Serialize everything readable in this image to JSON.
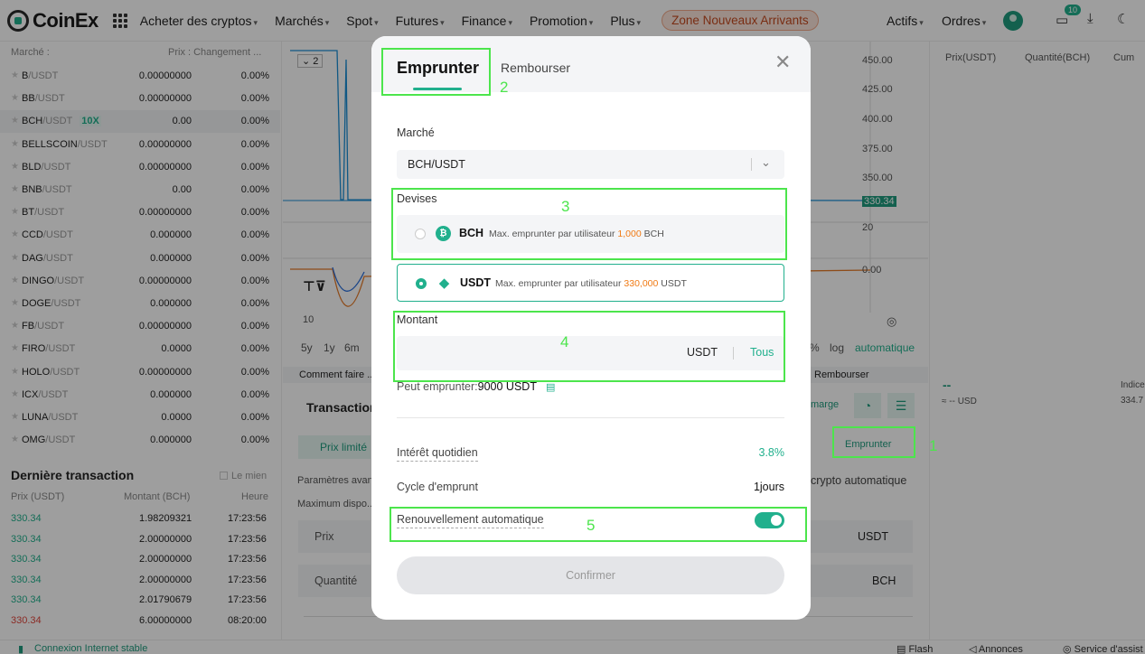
{
  "nav": {
    "brand": "CoinEx",
    "items": [
      "Acheter des cryptos",
      "Marchés",
      "Spot",
      "Futures",
      "Finance",
      "Promotion",
      "Plus"
    ],
    "zone": "Zone Nouveaux Arrivants",
    "right_items": [
      "Actifs",
      "Ordres"
    ],
    "notif_count": "10"
  },
  "market": {
    "header": "Marché :",
    "header2": "Prix : Changement ...",
    "rows": [
      {
        "base": "B",
        "quote": "/USDT",
        "price": "0.00000000",
        "chg": "0.00%"
      },
      {
        "base": "BB",
        "quote": "/USDT",
        "price": "0.00000000",
        "chg": "0.00%"
      },
      {
        "base": "BCH",
        "quote": "/USDT",
        "price": "0.00",
        "chg": "0.00%",
        "lev": "10X"
      },
      {
        "base": "BELLSCOIN",
        "quote": "/USDT",
        "price": "0.00000000",
        "chg": "0.00%"
      },
      {
        "base": "BLD",
        "quote": "/USDT",
        "price": "0.00000000",
        "chg": "0.00%"
      },
      {
        "base": "BNB",
        "quote": "/USDT",
        "price": "0.00",
        "chg": "0.00%"
      },
      {
        "base": "BT",
        "quote": "/USDT",
        "price": "0.00000000",
        "chg": "0.00%"
      },
      {
        "base": "CCD",
        "quote": "/USDT",
        "price": "0.000000",
        "chg": "0.00%"
      },
      {
        "base": "DAG",
        "quote": "/USDT",
        "price": "0.000000",
        "chg": "0.00%"
      },
      {
        "base": "DINGO",
        "quote": "/USDT",
        "price": "0.00000000",
        "chg": "0.00%"
      },
      {
        "base": "DOGE",
        "quote": "/USDT",
        "price": "0.000000",
        "chg": "0.00%"
      },
      {
        "base": "FB",
        "quote": "/USDT",
        "price": "0.00000000",
        "chg": "0.00%"
      },
      {
        "base": "FIRO",
        "quote": "/USDT",
        "price": "0.0000",
        "chg": "0.00%"
      },
      {
        "base": "HOLO",
        "quote": "/USDT",
        "price": "0.00000000",
        "chg": "0.00%"
      },
      {
        "base": "ICX",
        "quote": "/USDT",
        "price": "0.000000",
        "chg": "0.00%"
      },
      {
        "base": "LUNA",
        "quote": "/USDT",
        "price": "0.0000",
        "chg": "0.00%"
      },
      {
        "base": "OMG",
        "quote": "/USDT",
        "price": "0.000000",
        "chg": "0.00%"
      }
    ]
  },
  "last_trades": {
    "title": "Dernière transaction",
    "checkbox": "Le mien",
    "headers": [
      "Prix (USDT)",
      "Montant (BCH)",
      "Heure"
    ],
    "rows": [
      {
        "price": "330.34",
        "amount": "1.98209321",
        "time": "17:23:56",
        "side": "buy"
      },
      {
        "price": "330.34",
        "amount": "2.00000000",
        "time": "17:23:56",
        "side": "buy"
      },
      {
        "price": "330.34",
        "amount": "2.00000000",
        "time": "17:23:56",
        "side": "buy"
      },
      {
        "price": "330.34",
        "amount": "2.00000000",
        "time": "17:23:56",
        "side": "buy"
      },
      {
        "price": "330.34",
        "amount": "2.01790679",
        "time": "17:23:56",
        "side": "buy"
      },
      {
        "price": "330.34",
        "amount": "6.00000000",
        "time": "08:20:00",
        "side": "sell"
      }
    ]
  },
  "chart": {
    "y_ticks": [
      "450.00",
      "425.00",
      "400.00",
      "375.00",
      "350.00",
      "330.34",
      "20",
      "0.00"
    ],
    "periods": [
      "5y",
      "1y",
      "6m"
    ],
    "right_controls": [
      "%",
      "log",
      "automatique"
    ],
    "x_label": "10",
    "interval": "2"
  },
  "background": {
    "comment": "Comment faire ...",
    "rembourser": "Rembourser",
    "transaction": "Transaction",
    "prix_limite": "Prix limité",
    "params": "Paramètres avan...",
    "max": "Maximum dispo...",
    "prix": "Prix",
    "quantite": "Quantité",
    "marge": "marge",
    "emprunter_btn": "Emprunter",
    "crypto_auto": "crypto automatique",
    "usdt": "USDT",
    "bch": "BCH"
  },
  "orderbook": {
    "headers": [
      "Prix(USDT)",
      "Quantité(BCH)",
      "Cum"
    ],
    "dash": "--",
    "usd": "≈ -- USD",
    "indice": "Indice",
    "indice_val": "334.7"
  },
  "status": {
    "connection": "Connexion Internet stable",
    "flash": "Flash",
    "annonces": "Annonces",
    "service": "Service d'assist"
  },
  "modal": {
    "tab_borrow": "Emprunter",
    "tab_repay": "Rembourser",
    "market_label": "Marché",
    "market_value": "BCH/USDT",
    "currencies_label": "Devises",
    "coins": [
      {
        "name": "BCH",
        "desc_prefix": "Max. emprunter par utilisateur",
        "amount": "1,000",
        "unit": "BCH",
        "selected": false
      },
      {
        "name": "USDT",
        "desc_prefix": "Max. emprunter par utilisateur",
        "amount": "330,000",
        "unit": "USDT",
        "selected": true
      }
    ],
    "amount_label": "Montant",
    "amount_unit": "USDT",
    "amount_all": "Tous",
    "can_borrow_label": "Peut emprunter:",
    "can_borrow_value": "9000 USDT",
    "daily_interest_label": "Intérêt quotidien",
    "daily_interest_value": "3.8%",
    "cycle_label": "Cycle d'emprunt",
    "cycle_value": "1jours",
    "auto_renew_label": "Renouvellement automatique",
    "auto_renew_on": true,
    "confirm": "Confirmer"
  },
  "annotations": [
    "1",
    "2",
    "3",
    "4",
    "5"
  ],
  "colors": {
    "accent": "#21b08d",
    "amount": "#f07a14",
    "annotation": "#4ce54c",
    "sell": "#e0463c"
  }
}
